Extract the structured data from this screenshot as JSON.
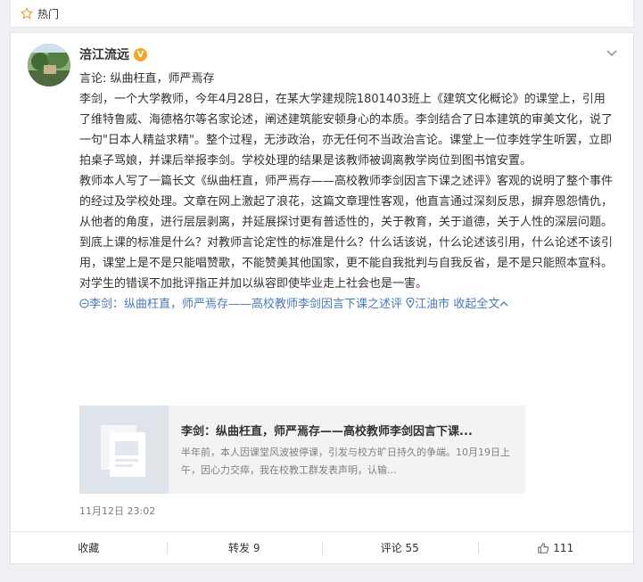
{
  "topbar": {
    "label": "热门"
  },
  "post": {
    "username": "涪江流远",
    "badge": "V",
    "paragraphs": [
      "言论: 纵曲枉直，师严焉存",
      "李剑，一个大学教师，今年4月28日，在某大学建规院1801403班上《建筑文化概论》的课堂上，引用了维特鲁威、海德格尔等名家论述，阐述建筑能安顿身心的本质。李剑结合了日本建筑的审美文化，说了一句\"日本人精益求精\"。整个过程，无涉政治，亦无任何不当政治言论。课堂上一位李姓学生听罢，立即拍桌子骂娘，并课后举报李剑。学校处理的结果是该教师被调离教学岗位到图书馆安置。",
      "教师本人写了一篇长文《纵曲枉直，师严焉存——高校教师李剑因言下课之述评》客观的说明了整个事件的经过及学校处理。文章在网上激起了浪花，这篇文章理性客观，他直言通过深刻反思，摒弃恩怨情仇，从他者的角度，进行层层剥离，并延展探讨更有普适性的，关于教育，关于道德，关于人性的深层问题。",
      "到底上课的标准是什么？对教师言论定性的标准是什么？什么话该说，什么论述该引用，什么论述不该引用，课堂上是不是只能唱赞歌，不能赞美其他国家，更不能自我批判与自我反省，是不是只能照本宣科。",
      "对学生的错误不加批评指正并加以纵容即使毕业走上社会也是一害。"
    ],
    "link_article": "李剑：纵曲枉直，师严焉存——高校教师李剑因言下课之述评",
    "link_location": "江油市",
    "link_collapse": "收起全文",
    "preview": {
      "title": "李剑：纵曲枉直，师严焉存——高校教师李剑因言下课...",
      "desc": "半年前，本人因课堂风波被停课，引发与校方旷日持久的争端。10月19日上午，因心力交瘁，我在校教工群发表声明，认输..."
    },
    "time": "11月12日 23:02"
  },
  "actions": {
    "collect": "收藏",
    "repost": "转发 9",
    "comment": "评论 55",
    "like": "111"
  },
  "colors": {
    "accent": "#4b7ab8",
    "badge": "#f5a623",
    "star": "#e8a33b"
  }
}
